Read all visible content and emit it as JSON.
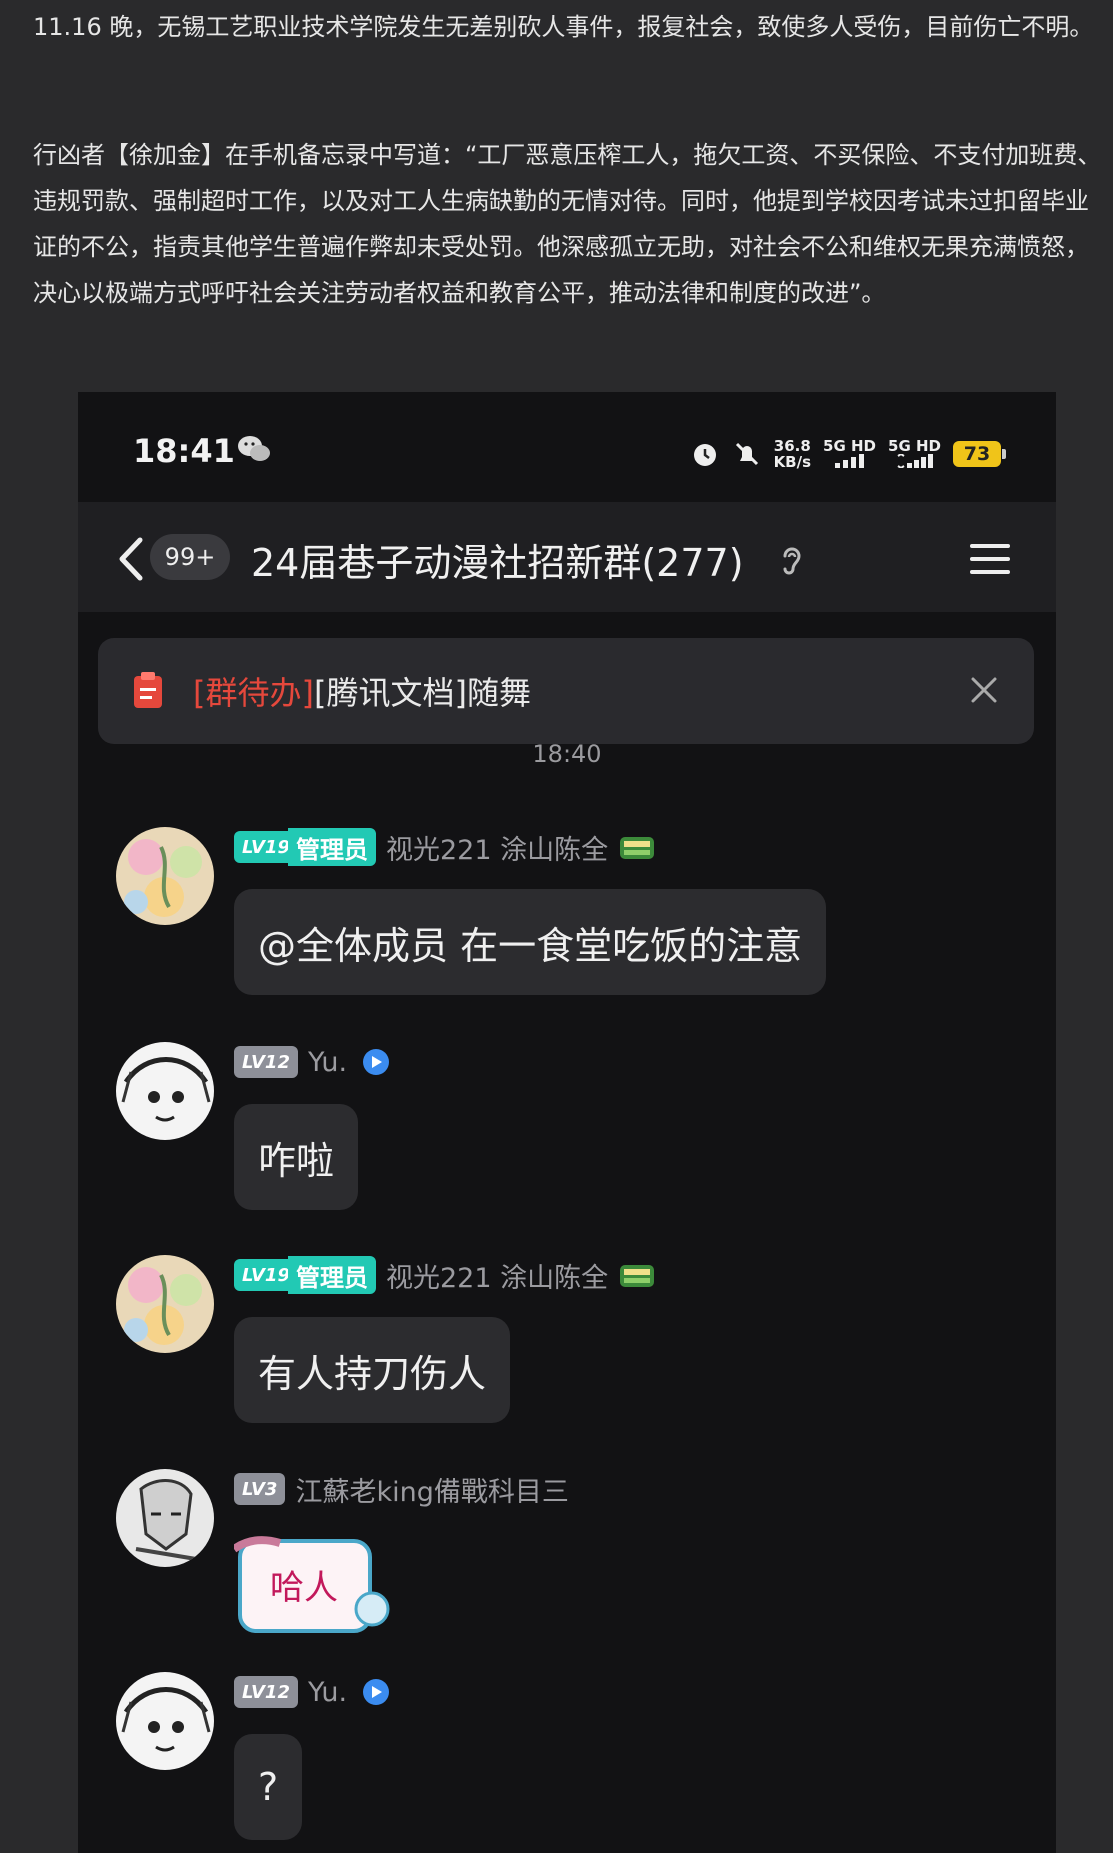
{
  "article": {
    "para1": "11.16 晚，无锡工艺职业技术学院发生无差别砍人事件，报复社会，致使多人受伤，目前伤亡不明。",
    "para2": "行凶者【徐加金】在手机备忘录中写道：“工厂恶意压榨工人，拖欠工资、不买保险、不支付加班费、违规罚款、强制超时工作，以及对工人生病缺勤的无情对待。同时，他提到学校因考试未过扣留毕业证的不公，指责其他学生普遍作弊却未受处罚。他深感孤立无助，对社会不公和维权无果充满愤怒，决心以极端方式呼吁社会关注劳动者权益和教育公平，推动法律和制度的改进”。"
  },
  "statusbar": {
    "time": "18:41",
    "speed_value": "36.8",
    "speed_unit": "KB/s",
    "net1": "5G HD",
    "net2": "5G HD",
    "battery": "73"
  },
  "header": {
    "unread_badge": "99+",
    "title": "24届巷子动漫社招新群(277)"
  },
  "pinned": {
    "tag": "[群待办]",
    "text": "[腾讯文档]随舞"
  },
  "timestamp": "18:40",
  "messages": [
    {
      "level": "LV19",
      "role": "管理员",
      "name": "视光221 涂山陈全",
      "text": "@全体成员 在一食堂吃饭的注意"
    },
    {
      "level": "LV12",
      "role": "",
      "name": "Yu.",
      "text": "咋啦"
    },
    {
      "level": "LV19",
      "role": "管理员",
      "name": "视光221 涂山陈全",
      "text": "有人持刀伤人"
    },
    {
      "level": "LV3",
      "role": "",
      "name": "江蘇老king備戰科目三",
      "sticker_text": "哈人"
    },
    {
      "level": "LV12",
      "role": "",
      "name": "Yu.",
      "text": "?"
    }
  ],
  "colors": {
    "admin": "#22c9b4",
    "pin_tag": "#e5483c",
    "battery": "#f0c419"
  }
}
